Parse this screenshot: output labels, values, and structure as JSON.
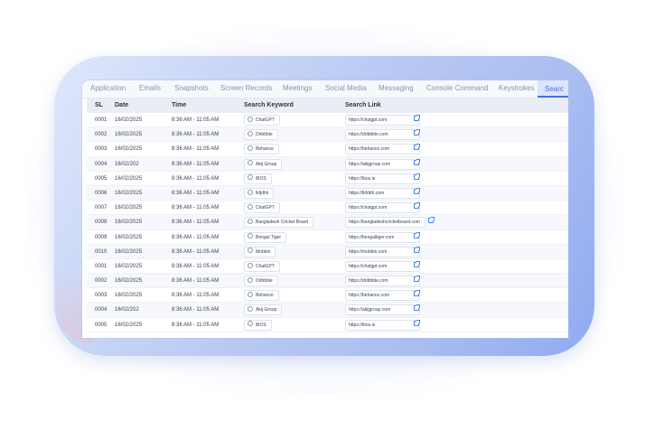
{
  "tabs": [
    {
      "label": "Application"
    },
    {
      "label": "Emails"
    },
    {
      "label": "Snapshots"
    },
    {
      "label": "Screen Records"
    },
    {
      "label": "Meetings"
    },
    {
      "label": "Social Media"
    },
    {
      "label": "Messaging"
    },
    {
      "label": "Console Command"
    },
    {
      "label": "Keystrokes"
    },
    {
      "label": "Searc"
    }
  ],
  "table": {
    "headers": {
      "sl": "SL",
      "date": "Date",
      "time": "Time",
      "keyword": "Search Keyword",
      "link": "Search Link"
    },
    "rows": [
      {
        "sl": "0001",
        "date": "16/02/2025",
        "time": "8:36 AM - 11:05 AM",
        "keyword": "ChatGPT",
        "link": "https://chatgpt.com"
      },
      {
        "sl": "0002",
        "date": "16/02/2025",
        "time": "8:36 AM - 11:05 AM",
        "keyword": "Dribbble",
        "link": "https://dribbble.com"
      },
      {
        "sl": "0003",
        "date": "16/02/2025",
        "time": "8:36 AM - 11:05 AM",
        "keyword": "Behance",
        "link": "https://behance.com"
      },
      {
        "sl": "0004",
        "date": "16/02/202",
        "time": "8:36 AM - 11:05 AM",
        "keyword": "Akij Group",
        "link": "https://akijgroup.com"
      },
      {
        "sl": "0005",
        "date": "16/02/2025",
        "time": "8:36 AM - 11:05 AM",
        "keyword": "iBOS",
        "link": "https://ibos.io"
      },
      {
        "sl": "0006",
        "date": "16/02/2025",
        "time": "8:36 AM - 11:05 AM",
        "keyword": "lkfjdhh",
        "link": "https://lkfddh.com"
      },
      {
        "sl": "0007",
        "date": "16/02/2025",
        "time": "8:36 AM - 11:05 AM",
        "keyword": "ChatGPT",
        "link": "https://chatgpt.com"
      },
      {
        "sl": "0008",
        "date": "16/02/2025",
        "time": "8:36 AM - 11:05 AM",
        "keyword": "Bangladesh Cricket Board",
        "link": "https://bangladeshcricketboard.com"
      },
      {
        "sl": "0009",
        "date": "16/02/2025",
        "time": "8:36 AM - 11:05 AM",
        "keyword": "Bengal Tiger",
        "link": "https://bengaltiger.com"
      },
      {
        "sl": "0010",
        "date": "16/02/2025",
        "time": "8:36 AM - 11:05 AM",
        "keyword": "Mobbin",
        "link": "https://mobbin.com"
      },
      {
        "sl": "0001",
        "date": "16/02/2025",
        "time": "8:36 AM - 11:05 AM",
        "keyword": "ChatGPT",
        "link": "https://chatgpt.com"
      },
      {
        "sl": "0002",
        "date": "16/02/2025",
        "time": "8:36 AM - 11:05 AM",
        "keyword": "Dribbble",
        "link": "https://dribbble.com"
      },
      {
        "sl": "0003",
        "date": "16/02/2025",
        "time": "8:36 AM - 11:05 AM",
        "keyword": "Behance",
        "link": "https://behance.com"
      },
      {
        "sl": "0004",
        "date": "16/02/202",
        "time": "8:36 AM - 11:05 AM",
        "keyword": "Akij Group",
        "link": "https://akijgroup.com"
      },
      {
        "sl": "0005",
        "date": "16/02/2025",
        "time": "8:36 AM - 11:05 AM",
        "keyword": "iBOS",
        "link": "https://ibos.io"
      }
    ]
  },
  "icons": {
    "search": "search-icon",
    "external": "external-link-icon"
  },
  "colors": {
    "accent": "#4a6ee0",
    "frame": "#b8c8f3",
    "header_bg": "#e9edf5"
  }
}
